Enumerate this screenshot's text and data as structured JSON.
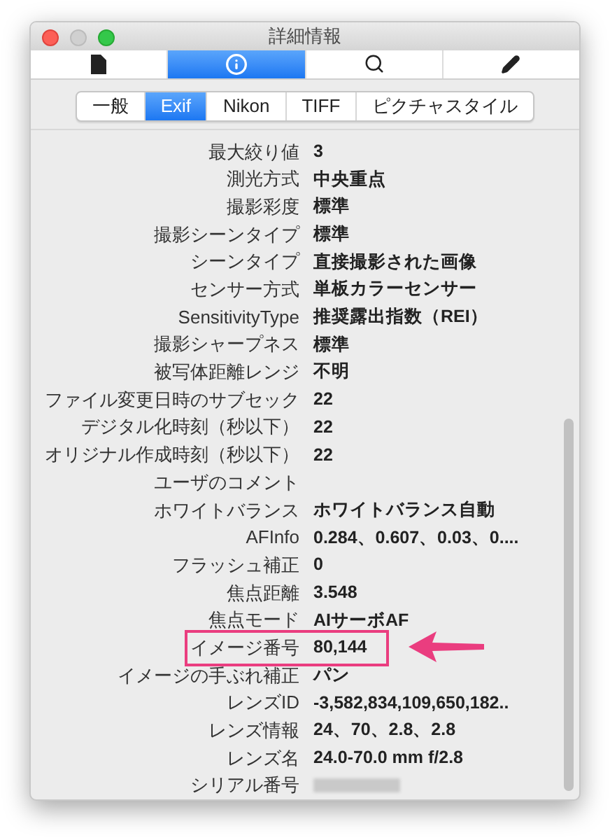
{
  "window": {
    "title": "詳細情報"
  },
  "toolbar": [
    {
      "kind": "document",
      "selected": false
    },
    {
      "kind": "info",
      "selected": true
    },
    {
      "kind": "search",
      "selected": false
    },
    {
      "kind": "edit",
      "selected": false
    }
  ],
  "tabs": [
    {
      "label": "一般",
      "selected": false
    },
    {
      "label": "Exif",
      "selected": true
    },
    {
      "label": "Nikon",
      "selected": false
    },
    {
      "label": "TIFF",
      "selected": false
    },
    {
      "label": "ピクチャスタイル",
      "selected": false
    }
  ],
  "rows": [
    {
      "label": "最大絞り値",
      "value": "3",
      "highlighted": false
    },
    {
      "label": "測光方式",
      "value": "中央重点",
      "highlighted": false
    },
    {
      "label": "撮影彩度",
      "value": "標準",
      "highlighted": false
    },
    {
      "label": "撮影シーンタイプ",
      "value": "標準",
      "highlighted": false
    },
    {
      "label": "シーンタイプ",
      "value": "直接撮影された画像",
      "highlighted": false
    },
    {
      "label": "センサー方式",
      "value": "単板カラーセンサー",
      "highlighted": false
    },
    {
      "label": "SensitivityType",
      "value": "推奨露出指数（REI）",
      "highlighted": false
    },
    {
      "label": "撮影シャープネス",
      "value": "標準",
      "highlighted": false
    },
    {
      "label": "被写体距離レンジ",
      "value": "不明",
      "highlighted": false
    },
    {
      "label": "ファイル変更日時のサブセック",
      "value": "22",
      "highlighted": false
    },
    {
      "label": "デジタル化時刻（秒以下）",
      "value": "22",
      "highlighted": false
    },
    {
      "label": "オリジナル作成時刻（秒以下）",
      "value": "22",
      "highlighted": false
    },
    {
      "label": "ユーザのコメント",
      "highlighted": false
    },
    {
      "label": "ホワイトバランス",
      "value": "ホワイトバランス自動",
      "highlighted": false
    },
    {
      "label": "AFInfo",
      "value": "0.284、0.607、0.03、0....",
      "highlighted": false
    },
    {
      "label": "フラッシュ補正",
      "value": "0",
      "highlighted": false
    },
    {
      "label": "焦点距離",
      "value": "3.548",
      "highlighted": false
    },
    {
      "label": "焦点モード",
      "value": "AIサーボAF",
      "highlighted": false
    },
    {
      "label": "イメージ番号",
      "value": "80,144",
      "highlighted": true
    },
    {
      "label": "イメージの手ぶれ補正",
      "value": "パン",
      "highlighted": false
    },
    {
      "label": "レンズID",
      "value": "-3,582,834,109,650,182..",
      "highlighted": false
    },
    {
      "label": "レンズ情報",
      "value": "24、70、2.8、2.8",
      "highlighted": false
    },
    {
      "label": "レンズ名",
      "value": "24.0-70.0 mm f/2.8",
      "highlighted": false
    },
    {
      "label": "シリアル番号",
      "redacted": true,
      "highlighted": false
    }
  ]
}
